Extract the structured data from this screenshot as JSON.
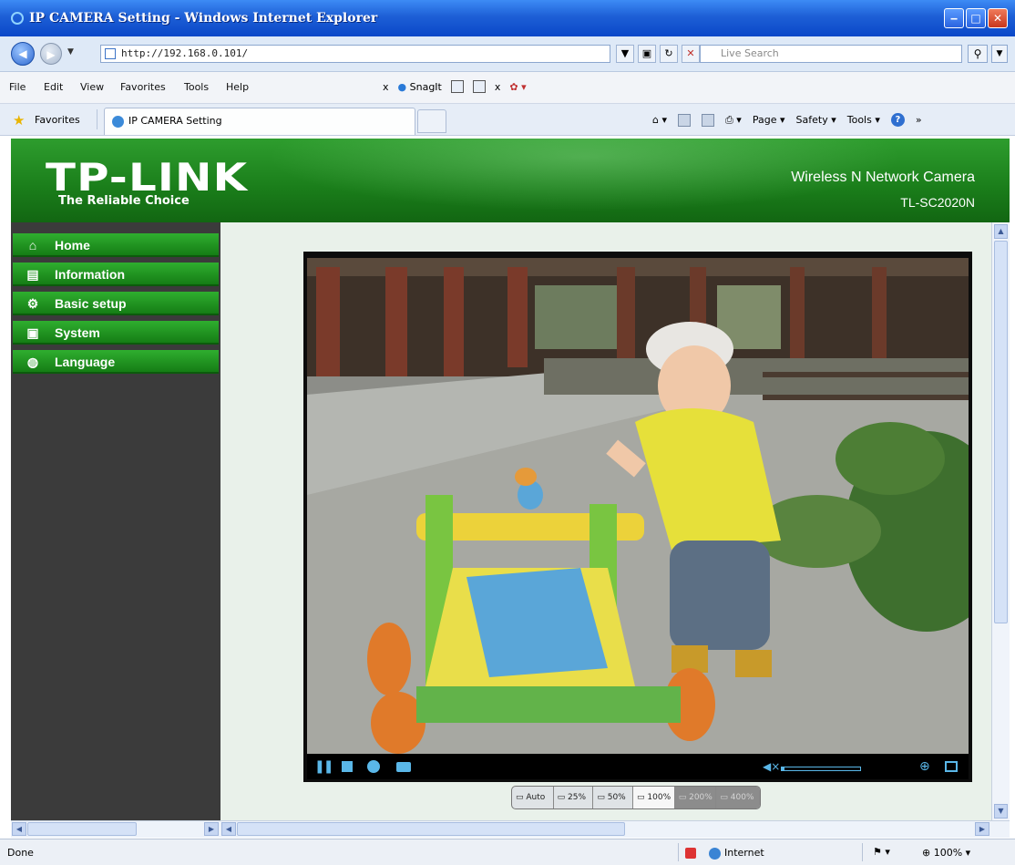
{
  "window": {
    "title": "IP CAMERA Setting - Windows Internet Explorer",
    "min": "‒",
    "max": "□",
    "close": "✕"
  },
  "address": {
    "url": "http://192.168.0.101/",
    "search_placeholder": "Live Search"
  },
  "menu": [
    "File",
    "Edit",
    "View",
    "Favorites",
    "Tools",
    "Help"
  ],
  "toolbar": {
    "close_x": "x",
    "snagit": "SnagIt",
    "close_x2": "x"
  },
  "favorites": {
    "label": "Favorites",
    "tab_title": "IP CAMERA Setting",
    "commands": {
      "page": "Page",
      "safety": "Safety",
      "tools": "Tools",
      "help": "?",
      "more": "»"
    }
  },
  "brand": {
    "logo": "TP-LINK",
    "tagline": "The Reliable Choice",
    "product": "Wireless N Network Camera",
    "model": "TL-SC2020N",
    "green": "#1a7d1a"
  },
  "nav": [
    {
      "label": "Home",
      "icon": "home-icon"
    },
    {
      "label": "Information",
      "icon": "document-icon"
    },
    {
      "label": "Basic setup",
      "icon": "gear-icon"
    },
    {
      "label": "System",
      "icon": "system-icon"
    },
    {
      "label": "Language",
      "icon": "globe-icon"
    }
  ],
  "player": {
    "volume": 0.05,
    "accent": "#5ab7e8"
  },
  "sizes": [
    {
      "label": "Auto",
      "state": "normal"
    },
    {
      "label": "25%",
      "state": "normal"
    },
    {
      "label": "50%",
      "state": "normal"
    },
    {
      "label": "100%",
      "state": "active"
    },
    {
      "label": "200%",
      "state": "disabled"
    },
    {
      "label": "400%",
      "state": "disabled"
    }
  ],
  "status": {
    "text": "Done",
    "zone": "Internet",
    "zoom": "100%"
  }
}
